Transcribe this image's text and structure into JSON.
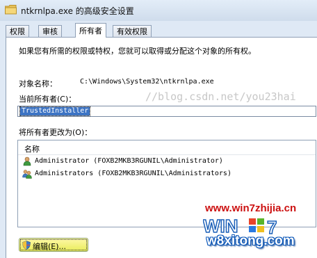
{
  "window": {
    "title": "ntkrnlpa.exe 的高级安全设置"
  },
  "tabs": [
    {
      "label": "权限"
    },
    {
      "label": "审核"
    },
    {
      "label": "所有者"
    },
    {
      "label": "有效权限"
    }
  ],
  "active_tab": "所有者",
  "owner_page": {
    "intro": "如果您有所需的权限或特权，您就可以取得或分配这个对象的所有权。",
    "object_name_label": "对象名称：",
    "object_name_value": "C:\\Windows\\System32\\ntkrnlpa.exe",
    "current_owner_label": "当前所有者(C)：",
    "current_owner_value": "TrustedInstaller",
    "change_owner_label": "将所有者更改为(O)：",
    "list": {
      "header": "名称",
      "items": [
        {
          "name": "Administrator (FOXB2MKB3RGUNIL\\Administrator)",
          "icon": "user-icon"
        },
        {
          "name": "Administrators (FOXB2MKB3RGUNIL\\Administrators)",
          "icon": "users-icon"
        }
      ]
    },
    "edit_button": "编辑(E)..."
  },
  "watermarks": {
    "url_fragment": "//blog.csdn.net/you23hai",
    "site1": "www.win7zhijia.cn",
    "logo": "WIN7",
    "site2": "w8xitong.com"
  },
  "colors": {
    "selection": "#3d74c4",
    "watermark_red": "#cc1010",
    "button_yellow": "#e8ec5a"
  }
}
